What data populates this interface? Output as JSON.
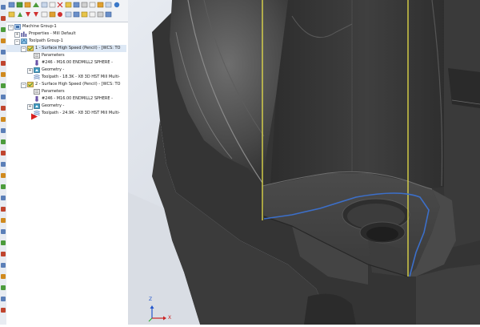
{
  "tree": {
    "root": "Machine Group-1",
    "properties": "Properties - Mill Default",
    "toolpath_group": "Toolpath Group-1",
    "op1": {
      "title": "1 - Surface High Speed (Pencil) - [WCS: TO",
      "parameters": "Parameters",
      "tool": "#246 - M16.00 ENDMILL2 SPHERE -",
      "geometry": "Geometry -",
      "toolpath": "Toolpath - 18.3K - X8 3D HST Mill Multi-"
    },
    "op2": {
      "title": "2 - Surface High Speed (Pencil) - [WCS: TO",
      "parameters": "Parameters",
      "tool": "#246 - M16.00 ENDMILL2 SPHERE -",
      "geometry": "Geometry -",
      "toolpath": "Toolpath - 24.9K - X8 3D HST Mill Multi-"
    }
  },
  "viewport": {
    "axis_z": "Z",
    "axis_x": "X"
  },
  "colors": {
    "toolpath_blue": "#3c6fc9",
    "tool_axis_yellow": "#e8e04a",
    "insert_arrow_red": "#d92020",
    "model_dark": "#3c3c3c",
    "background_light": "#dfe3ea"
  },
  "icons": {
    "machine_group": "machine-group-icon",
    "properties": "properties-icon",
    "toolpath_group": "toolpath-group-icon",
    "operation": "operation-icon",
    "parameters": "parameters-folder-icon",
    "tool": "tool-icon",
    "geometry": "geometry-icon",
    "toolpath": "toolpath-file-icon",
    "insert_arrow": "insert-arrow-icon"
  }
}
